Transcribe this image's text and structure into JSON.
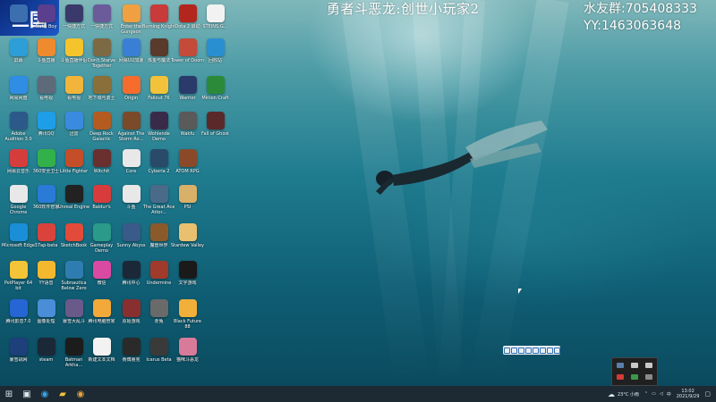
{
  "overlay": {
    "title": "勇者斗恶龙:创世小玩家2",
    "fan_group": "水友群:705408333",
    "yy": "YY:1463063648"
  },
  "logo_text": "三国",
  "desktop_columns": [
    [
      {
        "label": "",
        "icon": "app-icon",
        "color": "#3b6fb0"
      },
      {
        "label": "屏幕",
        "icon": "app-icon",
        "color": "#2d9ed8"
      },
      {
        "label": "网易网盘",
        "icon": "cloud-icon",
        "color": "#2f8de4"
      },
      {
        "label": "Adobe Audition 3.0",
        "icon": "audition-icon",
        "color": "#2b5a8a"
      },
      {
        "label": "网易云音乐",
        "icon": "netease-music-icon",
        "color": "#d53d3d"
      },
      {
        "label": "Google Chrome",
        "icon": "chrome-icon",
        "color": "#e8e8e8"
      },
      {
        "label": "Microsoft Edge",
        "icon": "edge-icon",
        "color": "#1a8fd8"
      },
      {
        "label": "PotPlayer 64 bit",
        "icon": "potplayer-icon",
        "color": "#f3c437"
      },
      {
        "label": "腾讯影音7.0",
        "icon": "video-icon",
        "color": "#2566d4"
      },
      {
        "label": "暴雪战网",
        "icon": "battlenet-icon",
        "color": "#1d3f7a"
      }
    ],
    [
      {
        "label": "Nuka Boy",
        "icon": "app-icon",
        "color": "#5b3f8f"
      },
      {
        "label": "斗鱼直播",
        "icon": "douyu-icon",
        "color": "#f08a2f"
      },
      {
        "label": "看电视",
        "icon": "tv-icon",
        "color": "#5d6a7a"
      },
      {
        "label": "腾讯QQ",
        "icon": "qq-icon",
        "color": "#1e9ee8"
      },
      {
        "label": "360安全卫士",
        "icon": "security-icon",
        "color": "#32b14a"
      },
      {
        "label": "360软件管家",
        "icon": "software-icon",
        "color": "#2a7ad8"
      },
      {
        "label": "37ap-beta",
        "icon": "app-icon",
        "color": "#d9433b"
      },
      {
        "label": "YY语音",
        "icon": "yy-icon",
        "color": "#f3b82e"
      },
      {
        "label": "图像处理",
        "icon": "image-icon",
        "color": "#4a8ed8"
      },
      {
        "label": "steam",
        "icon": "steam-icon",
        "color": "#1b2838"
      }
    ],
    [
      {
        "label": "一快捷方式",
        "icon": "game-icon",
        "color": "#3a3a6a"
      },
      {
        "label": "斗鱼直播伴侣",
        "icon": "live-icon",
        "color": "#f5c42c"
      },
      {
        "label": "看电视",
        "icon": "tv-icon",
        "color": "#f2b43a"
      },
      {
        "label": "迅雷",
        "icon": "thunder-icon",
        "color": "#3a8be0"
      },
      {
        "label": "Little Fighter",
        "icon": "game-icon",
        "color": "#c44d2a"
      },
      {
        "label": "Unreal Engine",
        "icon": "unreal-icon",
        "color": "#222"
      },
      {
        "label": "SketchBook",
        "icon": "sketch-icon",
        "color": "#e24b3a"
      },
      {
        "label": "Subnautica Below Zero",
        "icon": "game-icon",
        "color": "#2f7db0"
      },
      {
        "label": "暴雪大乱斗",
        "icon": "game-icon",
        "color": "#6a5a8a"
      },
      {
        "label": "Batman Arkha...",
        "icon": "batman-icon",
        "color": "#1c1c1c"
      }
    ],
    [
      {
        "label": "一快捷方式",
        "icon": "game-icon",
        "color": "#6b5b9a"
      },
      {
        "label": "Don't Starve Together",
        "icon": "game-icon",
        "color": "#7d6a44"
      },
      {
        "label": "地下城与勇士",
        "icon": "game-icon",
        "color": "#8a6f3a"
      },
      {
        "label": "Deep Rock Galactic",
        "icon": "game-icon",
        "color": "#b35b20"
      },
      {
        "label": "Witchit",
        "icon": "game-icon",
        "color": "#6a2f2f"
      },
      {
        "label": "Baldur's",
        "icon": "game-icon",
        "color": "#d83b3b"
      },
      {
        "label": "Gameplay Demo",
        "icon": "game-icon",
        "color": "#2a9a8a"
      },
      {
        "label": "微信",
        "icon": "wechat-icon",
        "color": "#d94aa2"
      },
      {
        "label": "腾讯电脑管家",
        "icon": "app-icon",
        "color": "#f2a93a"
      },
      {
        "label": "新建文本文档",
        "icon": "text-file-icon",
        "color": "#f2f2f2"
      }
    ],
    [
      {
        "label": "Enter the Gungeon",
        "icon": "gungeon-icon",
        "color": "#f0a040"
      },
      {
        "label": "网易UU加速",
        "icon": "uu-icon",
        "color": "#3a7fd6"
      },
      {
        "label": "Origin",
        "icon": "origin-icon",
        "color": "#f56c2d"
      },
      {
        "label": "Against The Storm Ro...",
        "icon": "game-icon",
        "color": "#7a4a2a"
      },
      {
        "label": "Core",
        "icon": "core-icon",
        "color": "#e8e8e8"
      },
      {
        "label": "斗鱼",
        "icon": "app-icon",
        "color": "#e8e8e8"
      },
      {
        "label": "Sunny Abyss",
        "icon": "game-icon",
        "color": "#3a5a8a"
      },
      {
        "label": "腾讯中心",
        "icon": "steam-icon",
        "color": "#1b2838"
      },
      {
        "label": "原始游戏",
        "icon": "game-icon",
        "color": "#8a2f2f"
      },
      {
        "label": "赛博朋克",
        "icon": "game-icon",
        "color": "#2a2a2a"
      }
    ],
    [
      {
        "label": "Burning Knight",
        "icon": "game-icon",
        "color": "#c93a3a"
      },
      {
        "label": "炼金与魔法",
        "icon": "game-icon",
        "color": "#5a3a2a"
      },
      {
        "label": "Fallout 76",
        "icon": "fallout-icon",
        "color": "#f2c23a"
      },
      {
        "label": "Wohlende Demo",
        "icon": "game-icon",
        "color": "#3a2a4a"
      },
      {
        "label": "Cyberia 2",
        "icon": "game-icon",
        "color": "#2a4a6a"
      },
      {
        "label": "The Great Ace Attor...",
        "icon": "game-icon",
        "color": "#4a6a8a"
      },
      {
        "label": "魔兽世界",
        "icon": "game-icon",
        "color": "#8a5a2a"
      },
      {
        "label": "Undermine",
        "icon": "game-icon",
        "color": "#a03a2a"
      },
      {
        "label": "赤兔",
        "icon": "game-icon",
        "color": "#6a6a6a"
      },
      {
        "label": "Icarus Beta",
        "icon": "game-icon",
        "color": "#3a3a3a"
      }
    ],
    [
      {
        "label": "Dota 2 启动",
        "icon": "dota-icon",
        "color": "#b3261e"
      },
      {
        "label": "Tower of Doom",
        "icon": "game-icon",
        "color": "#c44a3a"
      },
      {
        "label": "Warrior",
        "icon": "game-icon",
        "color": "#2a3a6a"
      },
      {
        "label": "Wakfu",
        "icon": "game-icon",
        "color": "#5a5a5a"
      },
      {
        "label": "ATOM RPG",
        "icon": "game-icon",
        "color": "#8a4a2a"
      },
      {
        "label": "PSI",
        "icon": "game-icon",
        "color": "#d8b068"
      },
      {
        "label": "Stardew Valley",
        "icon": "stardew-icon",
        "color": "#e8c070"
      },
      {
        "label": "文字游戏",
        "icon": "game-icon",
        "color": "#1a1a1a"
      },
      {
        "label": "Black Future 88",
        "icon": "game-icon",
        "color": "#f2b03a"
      },
      {
        "label": "猫咪斗恶龙",
        "icon": "game-icon",
        "color": "#d87a9a"
      }
    ],
    [
      {
        "label": "STEINS;G...",
        "icon": "text-file-icon",
        "color": "#f2f2f2"
      },
      {
        "label": "回收站",
        "icon": "app-icon",
        "color": "#2a8fd0"
      },
      {
        "label": "Minion Craft",
        "icon": "globe-icon",
        "color": "#2a8a3a"
      },
      {
        "label": "Fall of Ghost",
        "icon": "game-icon",
        "color": "#5a2a2a"
      }
    ]
  ],
  "taskbar": {
    "weather": "23°C 小雨",
    "time": "13:02",
    "date": "2021/9/29"
  }
}
